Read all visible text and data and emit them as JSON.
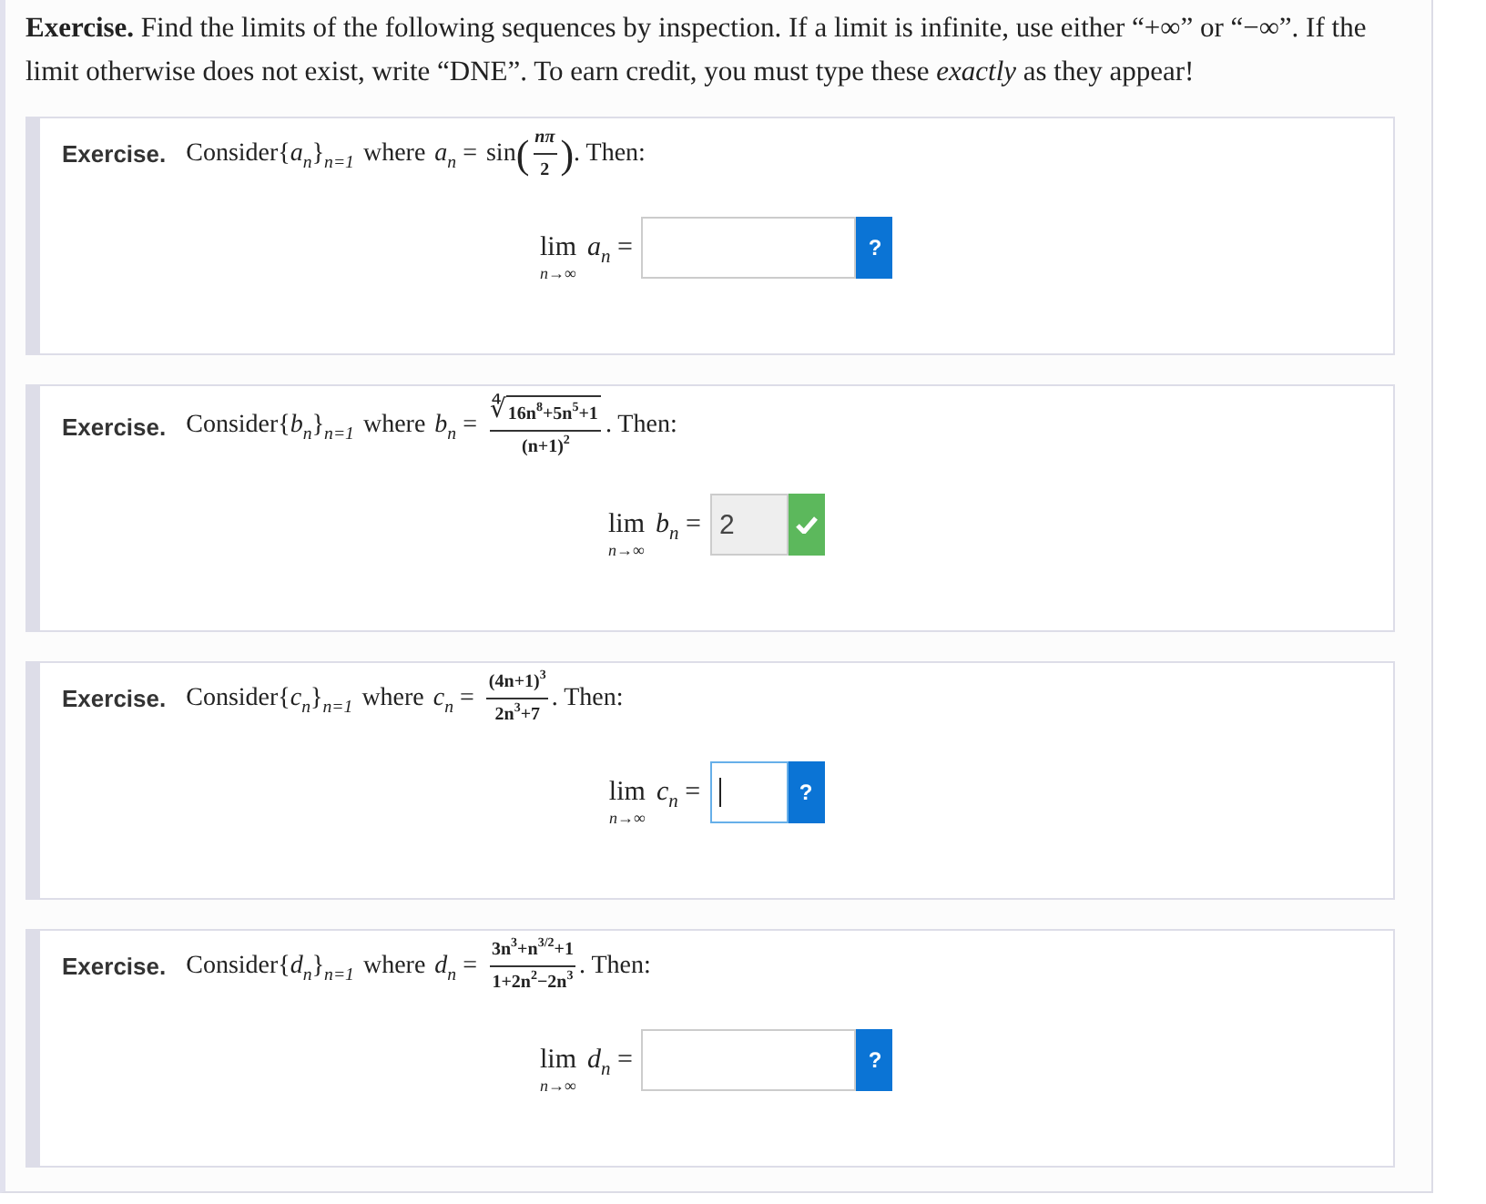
{
  "intro": "**Exercise.** Find the limits of the following sequences by inspection. If a limit is infinite, use either “+∞” or “−∞”. If the limit otherwise does not exist, write “DNE”. To earn credit, you must type these *exactly* as they appear!",
  "exercises": [
    {
      "label": "Exercise.",
      "consider": "Consider",
      "sequence": "{*a*$_{n}$}$_{n=1}$",
      "where": "where",
      "term": "*a*$_{n}$ =",
      "formula": {
        "kind": "function",
        "name": "sin",
        "open": "(",
        "numerator": "*nπ*",
        "denominator": "2",
        "close": ")"
      },
      "then": ". Then:",
      "limit": {
        "operator": "lim",
        "under": "*n*→∞",
        "term": "*a*$_{n}$ ="
      },
      "answer": {
        "focused": false,
        "correct": false,
        "help": "?"
      }
    },
    {
      "label": "Exercise.",
      "consider": "Consider",
      "sequence": "{*b*$_{n}$}$_{n=1}$",
      "where": "where",
      "term": "*b*$_{n}$ =",
      "formula": {
        "kind": "root_fraction",
        "root": "∜",
        "numerator": "16n$^{8}$+5n$^{5}$+1",
        "denominator": "(n+1)$^{2}$"
      },
      "then": ". Then:",
      "limit": {
        "operator": "lim",
        "under": "*n*→∞",
        "term": "*b*$_{n}$ ="
      },
      "answer": {
        "value": "2",
        "focused": false,
        "correct": true
      }
    },
    {
      "label": "Exercise.",
      "consider": "Consider",
      "sequence": "{*c*$_{n}$}$_{n=1}$",
      "where": "where",
      "term": "*c*$_{n}$ =",
      "formula": {
        "kind": "fraction",
        "numerator": "(4n+1)$^{3}$",
        "denominator": "2n$^{3}$+7"
      },
      "then": ". Then:",
      "limit": {
        "operator": "lim",
        "under": "*n*→∞",
        "term": "*c*$_{n}$ ="
      },
      "answer": {
        "focused": true,
        "correct": false,
        "help": "?"
      }
    },
    {
      "label": "Exercise.",
      "consider": "Consider",
      "sequence": "{*d*$_{n}$}$_{n=1}$",
      "where": "where",
      "term": "*d*$_{n}$ =",
      "formula": {
        "kind": "fraction",
        "numerator": "3n$^{3}$+n$^{3/2}$+1",
        "denominator": "1+2n$^{2}$−2n$^{3}$"
      },
      "then": ". Then:",
      "limit": {
        "operator": "lim",
        "under": "*n*→∞",
        "term": "*d*$_{n}$ ="
      },
      "answer": {
        "focused": false,
        "correct": false,
        "help": "?"
      }
    }
  ]
}
